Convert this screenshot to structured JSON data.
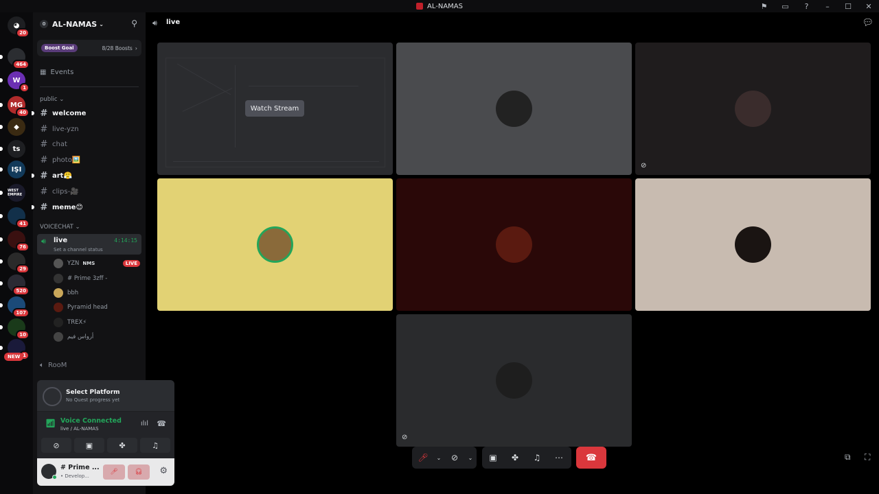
{
  "window": {
    "title": "AL-NAMAS"
  },
  "rail": {
    "home_badge": "20",
    "servers": [
      {
        "label": "",
        "badge": "464",
        "color": "#2b2d31"
      },
      {
        "label": "W",
        "badge": "1",
        "color": "#6b2fb3"
      },
      {
        "label": "MG",
        "badge": "40",
        "color": "#b02b2b"
      },
      {
        "label": "◆",
        "badge": "",
        "color": "#3a2a12"
      },
      {
        "label": "ts",
        "badge": "",
        "color": "#1e1f22"
      },
      {
        "label": "IŞI",
        "badge": "",
        "color": "#123a5a"
      },
      {
        "label": "WEST EMPIRE",
        "badge": "",
        "color": "#1a1a2a"
      },
      {
        "label": "",
        "badge": "41",
        "color": "#12304a"
      },
      {
        "label": "",
        "badge": "76",
        "color": "#3a1010"
      },
      {
        "label": "",
        "badge": "29",
        "color": "#2a2a2a"
      },
      {
        "label": "",
        "badge": "520",
        "color": "#2a2a33"
      },
      {
        "label": "",
        "badge": "107",
        "color": "#1b4a78"
      },
      {
        "label": "",
        "badge": "10",
        "color": "#1a3a1a"
      },
      {
        "label": "",
        "badge": "1",
        "color": "#1a1a3a"
      }
    ],
    "new_label": "NEW"
  },
  "server": {
    "name": "AL-NAMAS",
    "boost_label": "Boost Goal",
    "boost_count": "8/28 Boosts",
    "events": "Events"
  },
  "categories": {
    "public": "public",
    "voice": "VOICECHAT"
  },
  "channels": [
    {
      "name": "welcome",
      "unread": true
    },
    {
      "name": "live-yzn",
      "unread": false
    },
    {
      "name": "chat",
      "unread": false
    },
    {
      "name": "photo🖼️",
      "unread": false
    },
    {
      "name": "art😤",
      "unread": true
    },
    {
      "name": "clips-🎥",
      "unread": false
    },
    {
      "name": "meme😊",
      "unread": true
    }
  ],
  "voice_channel": {
    "name": "live",
    "timer": "4:14:15",
    "status_placeholder": "Set a channel status",
    "members": [
      {
        "name": "YZN",
        "tag": "NMS",
        "live": "LIVE"
      },
      {
        "name": "# Prime 3zff -",
        "tag": "",
        "live": ""
      },
      {
        "name": "bbh",
        "tag": "",
        "live": ""
      },
      {
        "name": "Pyramid head",
        "tag": "",
        "live": ""
      },
      {
        "name": "TREX⚡",
        "tag": "",
        "live": ""
      },
      {
        "name": "أرواس فيم",
        "tag": "",
        "live": ""
      }
    ],
    "other_room": "RooM"
  },
  "quest": {
    "title": "Select Platform",
    "subtitle": "No Quest progress yet"
  },
  "voice_status": {
    "title": "Voice Connected",
    "subtitle": "live / AL-NAMAS"
  },
  "user": {
    "name": "# Prime ...",
    "status": "• Develop..."
  },
  "main": {
    "channel": "live",
    "watch_stream": "Watch Stream"
  },
  "tiles": [
    {
      "bg": "#2b2c2f",
      "type": "stream"
    },
    {
      "bg": "#4a4b4e",
      "avatar": "#222"
    },
    {
      "bg": "#1f1c1d",
      "avatar": "#3a2c2c"
    },
    {
      "bg": "#e2d274",
      "avatar": "#c9a75a"
    },
    {
      "bg": "#2a0808",
      "avatar": "#5a1a10"
    },
    {
      "bg": "#c8bbb0",
      "avatar": "#1a1412"
    },
    {
      "bg": "#2a2b2d",
      "avatar": "#1e1e1e"
    }
  ]
}
